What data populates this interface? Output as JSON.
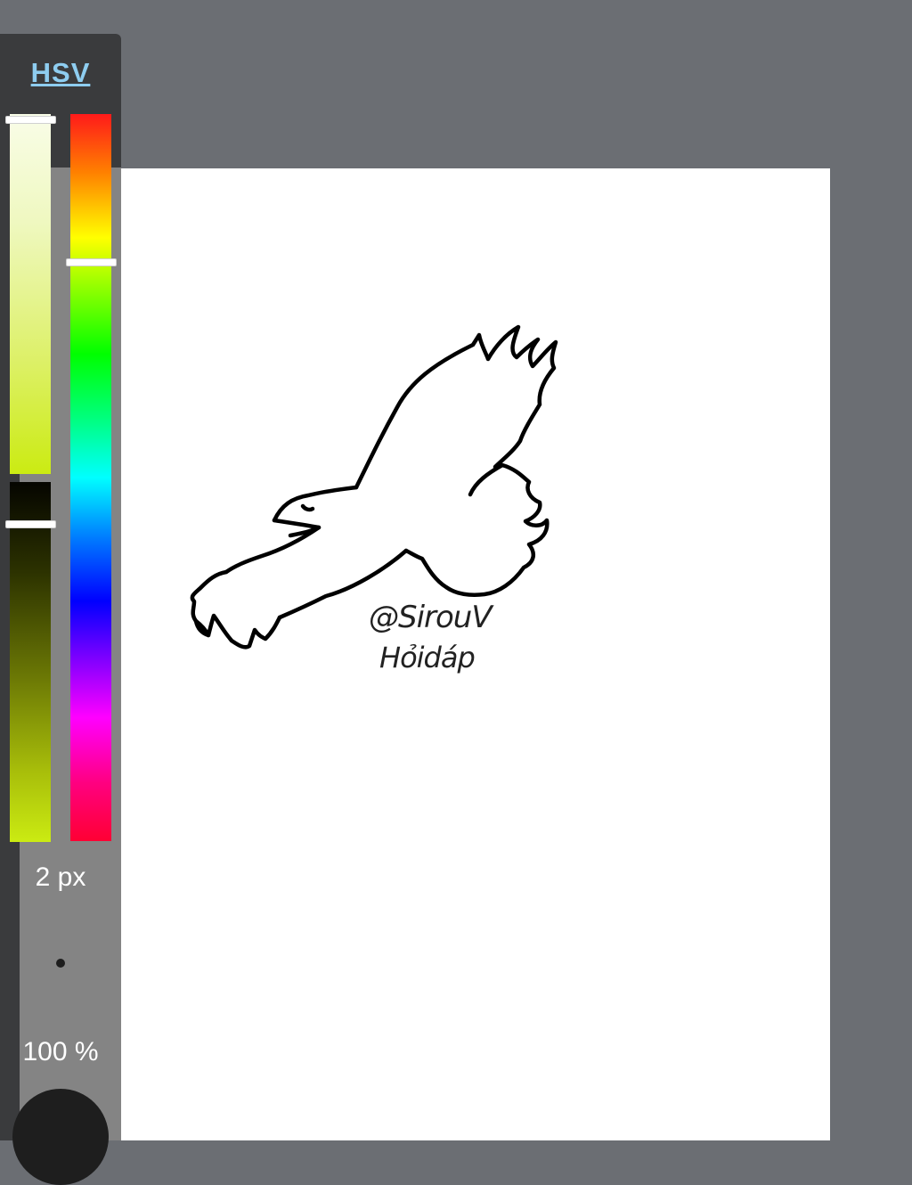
{
  "toolbar": {
    "mode_label": "HSV",
    "brush_size": "2 px",
    "opacity": "100 %"
  },
  "sliders": {
    "saturation_level": 0.0,
    "value_level": 0.11,
    "hue_level": 0.2
  },
  "colors": {
    "current_color": "#1e1e1e",
    "background": "#6b6e73",
    "panel": "#848484",
    "accent": "#8ecdf0"
  },
  "canvas": {
    "signature_line1": "@SirouV",
    "signature_line2": "Hỏidáp"
  }
}
